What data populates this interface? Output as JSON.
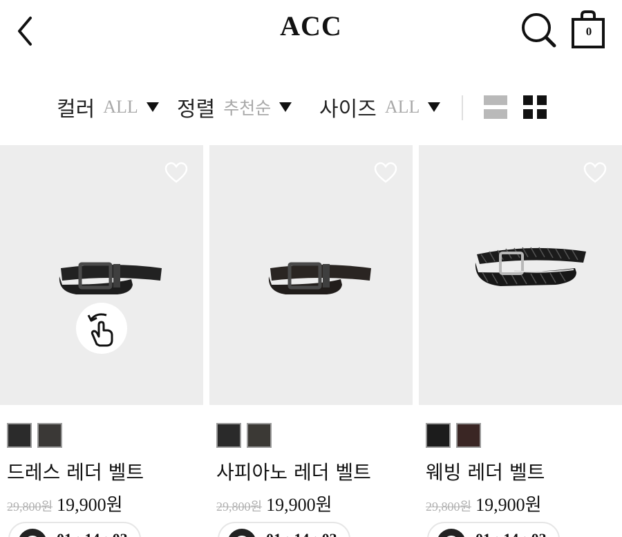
{
  "header": {
    "title": "ACC",
    "cart_count": "0"
  },
  "filters": [
    {
      "label": "컬러",
      "value": "ALL"
    },
    {
      "label": "정렬",
      "value": "추천순"
    },
    {
      "label": "사이즈",
      "value": "ALL"
    }
  ],
  "view": {
    "selected": "grid"
  },
  "products": [
    {
      "name": "드레스 레더 벨트",
      "original_price": "29,800원",
      "sale_price": "19,900원",
      "swatches": [
        "#2b2b2b",
        "#3a3836"
      ],
      "timer": "01 : 14 : 03",
      "belt_style": "dress",
      "has_rotate_badge": true
    },
    {
      "name": "사피아노 레더 벨트",
      "original_price": "29,800원",
      "sale_price": "19,900원",
      "swatches": [
        "#2a2a2a",
        "#3b3935"
      ],
      "timer": "01 : 14 : 03",
      "belt_style": "saffiano",
      "has_rotate_badge": false
    },
    {
      "name": "웨빙 레더 벨트",
      "original_price": "29,800원",
      "sale_price": "19,900원",
      "swatches": [
        "#1c1c1c",
        "#3a2624"
      ],
      "timer": "01 : 14 : 03",
      "belt_style": "braided",
      "has_rotate_badge": false
    }
  ],
  "colors": {
    "image_bg": "#ededed",
    "muted_text": "#a8a8a8",
    "primary_text": "#111111"
  }
}
